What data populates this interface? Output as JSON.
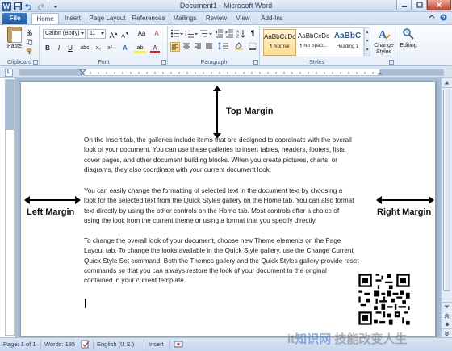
{
  "window": {
    "title": "Document1 - Microsoft Word",
    "controls": {
      "minimize": "–",
      "maximize": "□",
      "close": "✕"
    }
  },
  "quick_access": {
    "app_icon": "W"
  },
  "ribbon_tabs": [
    "File",
    "Home",
    "Insert",
    "Page Layout",
    "References",
    "Mailings",
    "Review",
    "View",
    "Add-Ins"
  ],
  "active_tab": "Home",
  "home_ribbon": {
    "clipboard": {
      "label": "Clipboard",
      "paste_label": "Paste"
    },
    "font": {
      "label": "Font",
      "font_name": "Calibri (Body)",
      "font_size": "11",
      "grow_label": "A",
      "shrink_label": "A",
      "case_label": "Aa",
      "clear_label": "A",
      "bold": "B",
      "italic": "I",
      "underline": "U",
      "strike": "abc",
      "subscript": "x₂",
      "superscript": "x²",
      "effects_label": "A",
      "highlight_label": "ab",
      "color_label": "A"
    },
    "paragraph": {
      "label": "Paragraph",
      "show_marks": "¶"
    },
    "styles": {
      "label": "Styles",
      "items": [
        {
          "sample": "AaBbCcDc",
          "name": "¶ Normal"
        },
        {
          "sample": "AaBbCcDc",
          "name": "¶ No Spaci..."
        },
        {
          "sample": "AaBbC",
          "name": "Heading 1"
        }
      ],
      "change_styles_label": "Change Styles",
      "editing_label": "Editing"
    }
  },
  "ruler": {
    "tab_selector": "L"
  },
  "annotations": {
    "top": "Top Margin",
    "left": "Left Margin",
    "right": "Right Margin"
  },
  "document": {
    "paragraphs": [
      [
        "On the Insert tab, the galleries include items that are designed to coordinate with the overall",
        "look of your document. You can use these galleries to insert tables, headers, footers, lists,",
        "cover pages, and other document building blocks. When you create pictures, charts, or",
        "diagrams, they also coordinate with your current document look."
      ],
      [
        "You can easily change the formatting of selected text in the document text by choosing a",
        "look for the selected text from the Quick Styles gallery on the Home tab. You can also format",
        "text directly by using the other controls on the Home tab. Most controls offer a choice of",
        "using the look from the current theme or using a format that you specify directly."
      ],
      [
        "To change the overall look of your document, choose new Theme elements on the Page",
        "Layout tab. To change the looks available in the Quick Style gallery, use the Change Current",
        "Quick Style Set command. Both the Themes gallery and the Quick Styles gallery provide reset",
        "commands so that you can always restore the look of your document to the original",
        "contained in your current template."
      ]
    ]
  },
  "status_bar": {
    "page": "Page: 1 of 1",
    "words": "Words: 185",
    "language": "English (U.S.)",
    "insert_mode": "Insert"
  },
  "watermark": {
    "left": "it",
    "rest": "知识网",
    "tail": "技能改变人生"
  },
  "colors": {
    "accent": "#2b5797",
    "file_tab": "#1f5ba6",
    "ribbon_border": "#a9bfd9",
    "workspace": "#a8bed6"
  }
}
